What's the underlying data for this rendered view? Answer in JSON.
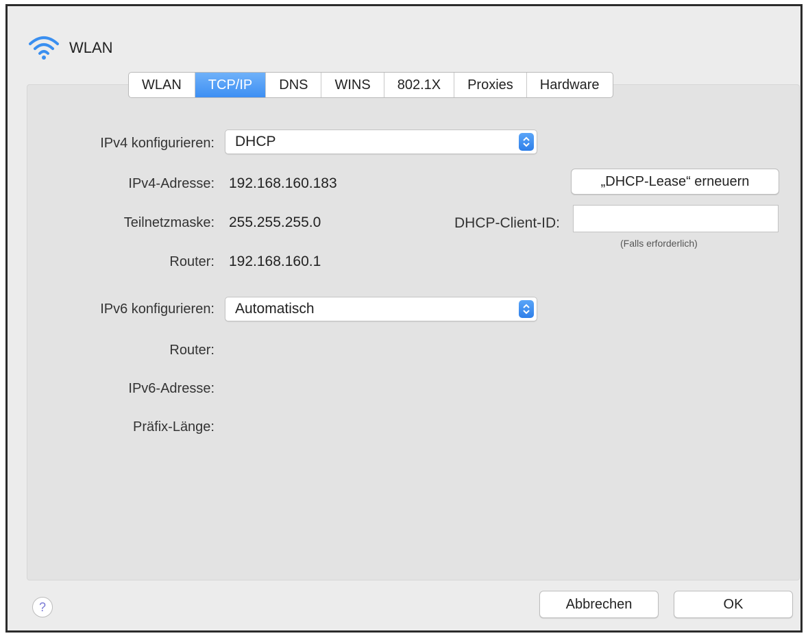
{
  "window": {
    "title": "WLAN"
  },
  "tabs": [
    {
      "label": "WLAN",
      "active": false
    },
    {
      "label": "TCP/IP",
      "active": true
    },
    {
      "label": "DNS",
      "active": false
    },
    {
      "label": "WINS",
      "active": false
    },
    {
      "label": "802.1X",
      "active": false
    },
    {
      "label": "Proxies",
      "active": false
    },
    {
      "label": "Hardware",
      "active": false
    }
  ],
  "ipv4": {
    "configure_label": "IPv4 konfigurieren:",
    "configure_value": "DHCP",
    "address_label": "IPv4-Adresse:",
    "address_value": "192.168.160.183",
    "subnet_label": "Teilnetzmaske:",
    "subnet_value": "255.255.255.0",
    "router_label": "Router:",
    "router_value": "192.168.160.1"
  },
  "dhcp": {
    "renew_button": "„DHCP-Lease“ erneuern",
    "client_id_label": "DHCP-Client-ID:",
    "client_id_value": "",
    "client_id_hint": "(Falls erforderlich)"
  },
  "ipv6": {
    "configure_label": "IPv6 konfigurieren:",
    "configure_value": "Automatisch",
    "router_label": "Router:",
    "address_label": "IPv6-Adresse:",
    "prefix_label": "Präfix-Länge:"
  },
  "footer": {
    "help": "?",
    "cancel_button": "Abbrechen",
    "ok_button": "OK"
  },
  "colors": {
    "accent": "#3d8ff3",
    "panel": "#e3e3e3",
    "window": "#ececec"
  },
  "icons": [
    "wifi-icon",
    "help-icon",
    "stepper-arrows-icon"
  ]
}
